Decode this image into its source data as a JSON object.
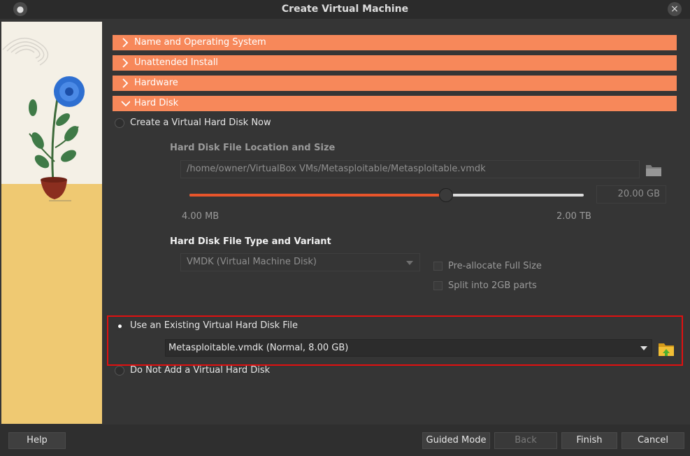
{
  "window": {
    "title": "Create Virtual Machine"
  },
  "sections": [
    {
      "label": "Name and Operating System",
      "expanded": false
    },
    {
      "label": "Unattended Install",
      "expanded": false
    },
    {
      "label": "Hardware",
      "expanded": false
    },
    {
      "label": "Hard Disk",
      "expanded": true
    }
  ],
  "hard_disk": {
    "option_create": "Create a Virtual Hard Disk Now",
    "location_heading": "Hard Disk File Location and Size",
    "location_path": "/home/owner/VirtualBox VMs/Metasploitable/Metasploitable.vmdk",
    "size_value": "20.00 GB",
    "size_min": "4.00 MB",
    "size_max": "2.00 TB",
    "size_fraction": 0.65,
    "type_heading": "Hard Disk File Type and Variant",
    "type_value": "VMDK (Virtual Machine Disk)",
    "preallocate_label": "Pre-allocate Full Size",
    "split_label": "Split into 2GB parts",
    "option_existing": "Use an Existing Virtual Hard Disk File",
    "existing_file": "Metasploitable.vmdk (Normal, 8.00 GB)",
    "option_none": "Do Not Add a Virtual Hard Disk",
    "selected_option": "existing"
  },
  "buttons": {
    "help": "Help",
    "guided_mode": "Guided Mode",
    "back": "Back",
    "finish": "Finish",
    "cancel": "Cancel"
  },
  "colors": {
    "section_header": "#f7885a",
    "slider_fill": "#e8552b",
    "highlight_border": "#e01010"
  },
  "icons": [
    "window-menu-icon",
    "close-icon",
    "chevron-right-icon",
    "chevron-down-icon",
    "folder-browse-icon",
    "folder-add-icon",
    "dropdown-arrow-icon"
  ]
}
